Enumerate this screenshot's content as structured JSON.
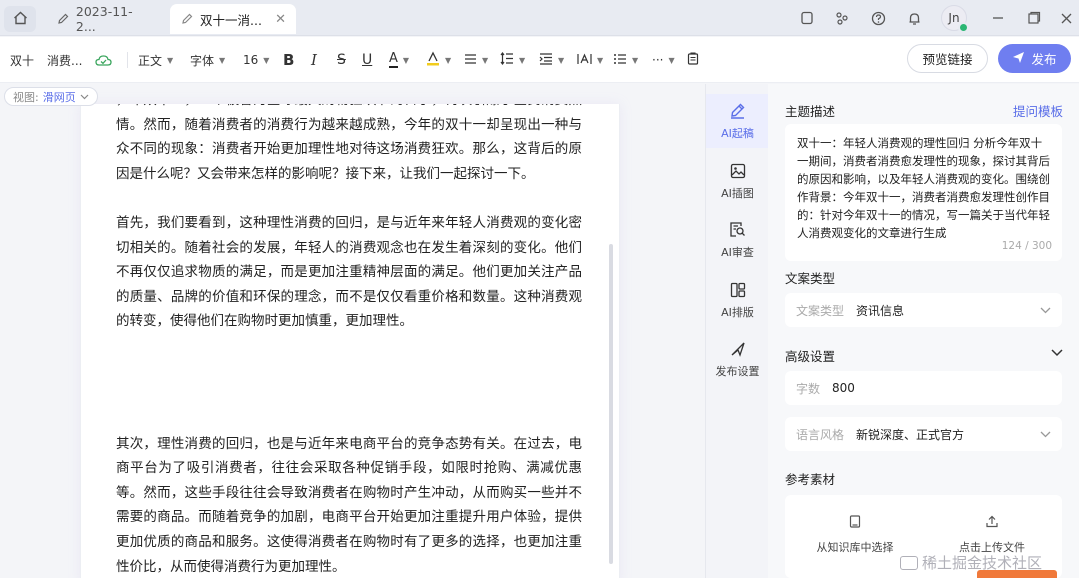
{
  "tabs": {
    "tab1_label": "2023-11-2...",
    "tab2_label": "双十一消...",
    "close_glyph": "✕"
  },
  "header": {
    "avatar_text": "Jn"
  },
  "toolbar": {
    "doc_title_short": "双十",
    "doc_category": "消费...",
    "paragraph_style": "正文",
    "font_family": "字体",
    "font_size": "16",
    "bold": "B",
    "italic": "I",
    "strike": "S",
    "underline": "U",
    "font_color": "A",
    "more": "···",
    "preview_label": "预览链接",
    "publish_label": "发布"
  },
  "view": {
    "label": "视图:",
    "value": "滑网页"
  },
  "document": {
    "paragraphs": [
      "，年双十一，一个被誉为全球最大购物狂欢节的日子，再次引爆了全民消费热情。然而，随着消费者的消费行为越来越成熟，今年的双十一却呈现出一种与众不同的现象：消费者开始更加理性地对待这场消费狂欢。那么，这背后的原因是什么呢？又会带来怎样的影响呢？接下来，让我们一起探讨一下。",
      "首先，我们要看到，这种理性消费的回归，是与近年来年轻人消费观的变化密切相关的。随着社会的发展，年轻人的消费观念也在发生着深刻的变化。他们不再仅仅追求物质的满足，而是更加注重精神层面的满足。他们更加关注产品的质量、品牌的价值和环保的理念，而不是仅仅看重价格和数量。这种消费观的转变，使得他们在购物时更加慎重，更加理性。",
      "其次，理性消费的回归，也是与近年来电商平台的竞争态势有关。在过去，电商平台为了吸引消费者，往往会采取各种促销手段，如限时抢购、满减优惠等。然而，这些手段往往会导致消费者在购物时产生冲动，从而购买一些并不需要的商品。而随着竞争的加剧，电商平台开始更加注重提升用户体验，提供更加优质的商品和服务。这使得消费者在购物时有了更多的选择，也更加注重性价比，从而使得消费行为更加理性。"
    ]
  },
  "rail": {
    "items": [
      {
        "label": "AI起稿",
        "icon": "pen-icon"
      },
      {
        "label": "AI插图",
        "icon": "image-icon"
      },
      {
        "label": "AI审查",
        "icon": "search-doc-icon"
      },
      {
        "label": "AI排版",
        "icon": "layout-icon"
      },
      {
        "label": "发布设置",
        "icon": "send-icon"
      }
    ]
  },
  "panel": {
    "topic_title": "主题描述",
    "topic_link": "提问模板",
    "topic_text": "双十一：年轻人消费观的理性回归 分析今年双十一期间，消费者消费愈发理性的现象，探讨其背后的原因和影响，以及年轻人消费观的变化。围绕创作背景：今年双十一，消费者消费愈发理性创作目的：针对今年双十一的情况，写一篇关于当代年轻人消费观变化的文章进行生成",
    "topic_counter": "124 / 300",
    "type_title": "文案类型",
    "type_label": "文案类型",
    "type_value": "资讯信息",
    "advanced_title": "高级设置",
    "words_label": "字数",
    "words_value": "800",
    "style_label": "语言风格",
    "style_value": "新锐深度、正式官方",
    "material_title": "参考素材",
    "upload_kb_label": "从知识库中选择",
    "upload_local_label": "点击上传文件"
  },
  "watermark": {
    "text": "稀土掘金技术社区"
  },
  "colors": {
    "accent": "#5a6ee8",
    "publish_bg": "#6f7ef0",
    "avatar_status": "#2bb673"
  }
}
